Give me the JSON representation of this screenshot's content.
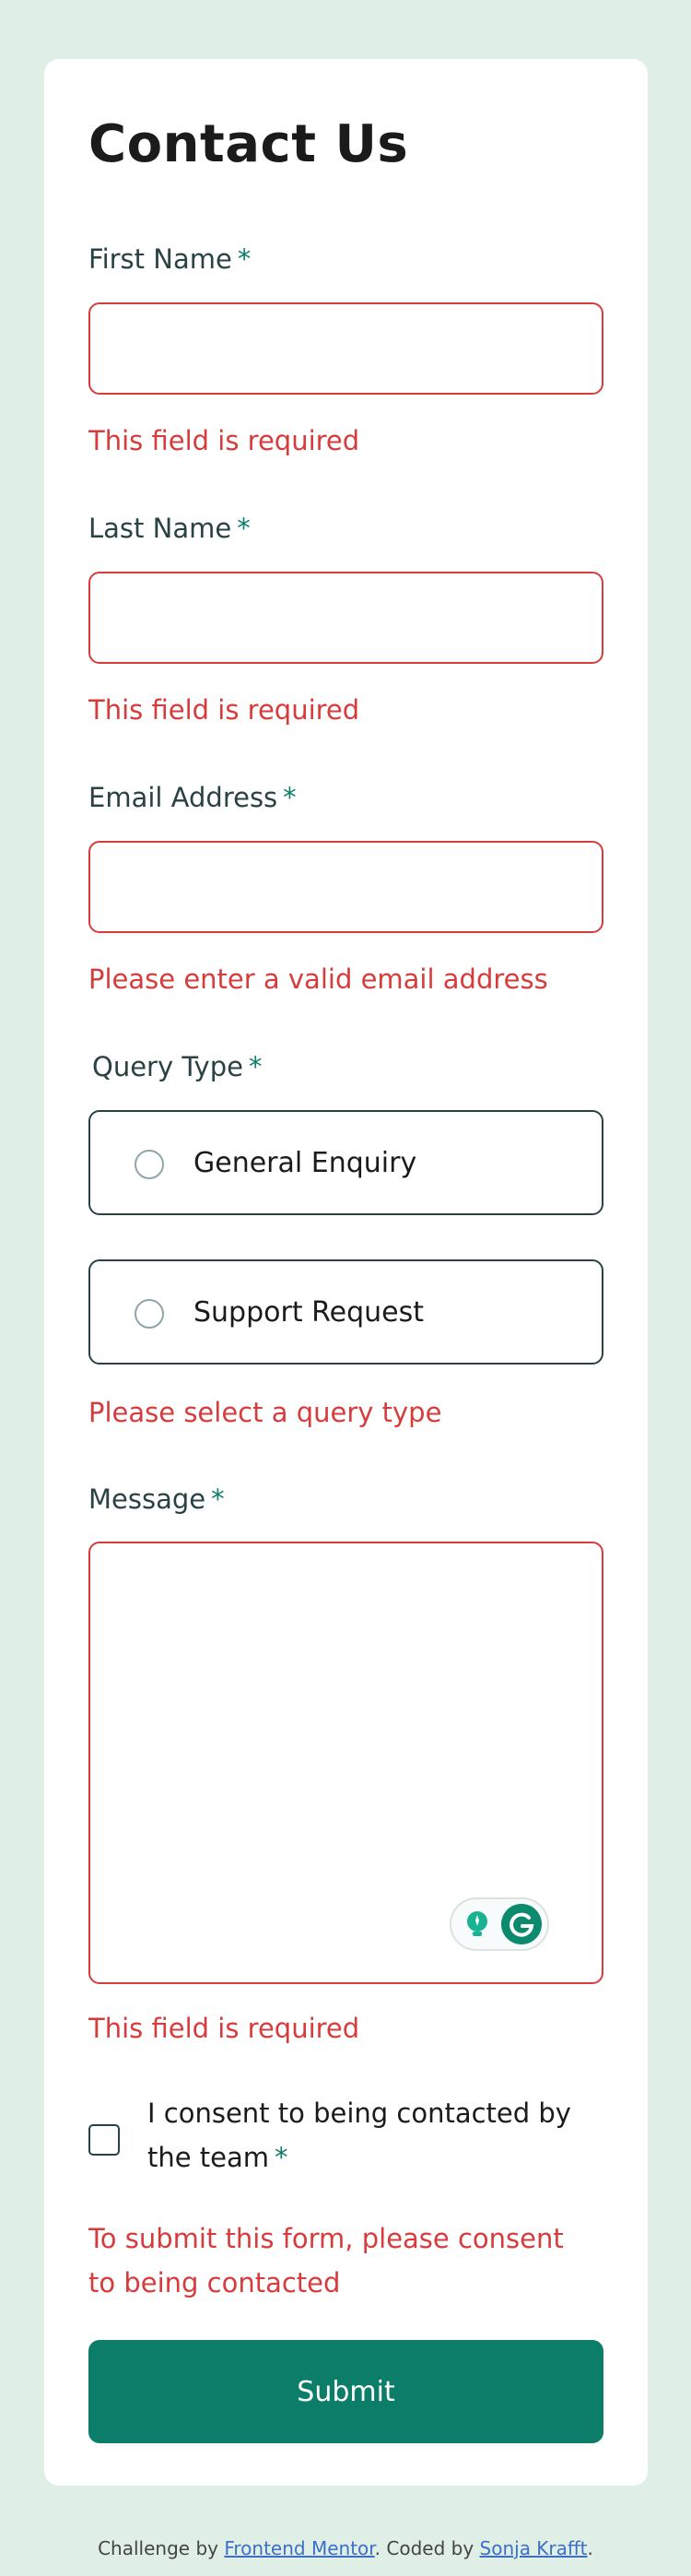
{
  "form": {
    "title": "Contact Us",
    "required_marker": "*",
    "first_name": {
      "label": "First Name",
      "value": "",
      "error": "This field is required"
    },
    "last_name": {
      "label": "Last Name",
      "value": "",
      "error": "This field is required"
    },
    "email": {
      "label": "Email Address",
      "value": "",
      "error": "Please enter a valid email address"
    },
    "query_type": {
      "label": "Query Type",
      "options": [
        "General Enquiry",
        "Support Request"
      ],
      "error": "Please select a query type"
    },
    "message": {
      "label": "Message",
      "value": "",
      "error": "This field is required"
    },
    "consent": {
      "label": "I consent to being contacted by the team",
      "error": "To submit this form, please consent to being contacted"
    },
    "submit_label": "Submit"
  },
  "footer": {
    "prefix": "Challenge by",
    "challenge_link": "Frontend Mentor",
    "middle": ". Coded by",
    "author_link": "Sonja Krafft",
    "suffix": "."
  },
  "colors": {
    "background": "#dfefe6",
    "accent": "#0c7d69",
    "error": "#d73c3c",
    "text": "#2a4244"
  },
  "icons": [
    "grammarly-bulb-icon",
    "grammarly-g-icon"
  ]
}
